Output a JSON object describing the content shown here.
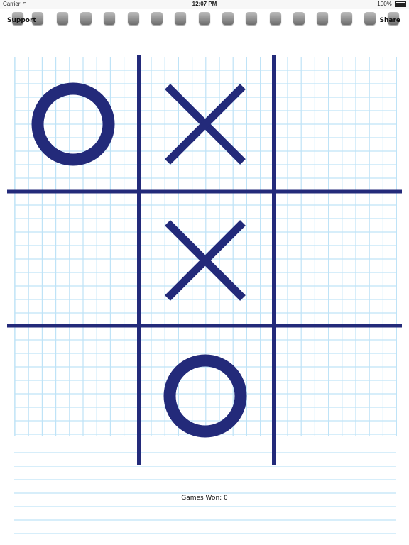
{
  "status_bar": {
    "carrier": "Carrier",
    "time": "12:07 PM",
    "battery": "100%"
  },
  "nav": {
    "support_label": "Support",
    "share_label": "Share"
  },
  "board": {
    "mark_color": "#232a7a",
    "grid_color": "#bfe3f7",
    "cells": [
      [
        "O",
        "X",
        ""
      ],
      [
        "",
        "X",
        ""
      ],
      [
        "",
        "O",
        ""
      ]
    ]
  },
  "footer": {
    "games_won": "Games Won: 0"
  }
}
